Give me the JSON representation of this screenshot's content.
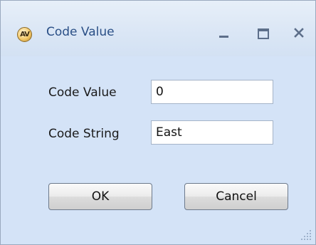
{
  "window": {
    "title": "Code Value",
    "icon": "app-logo-icon",
    "icon_text": "AV",
    "controls": {
      "minimize_icon": "minimize-icon",
      "maximize_icon": "maximize-icon",
      "close_icon": "close-icon"
    }
  },
  "form": {
    "code_value": {
      "label": "Code Value",
      "value": "0"
    },
    "code_string": {
      "label": "Code String",
      "value": "East"
    }
  },
  "buttons": {
    "ok_label": "OK",
    "cancel_label": "Cancel"
  },
  "colors": {
    "window_background": "#d4e3f7",
    "title_text": "#2a4f86"
  }
}
